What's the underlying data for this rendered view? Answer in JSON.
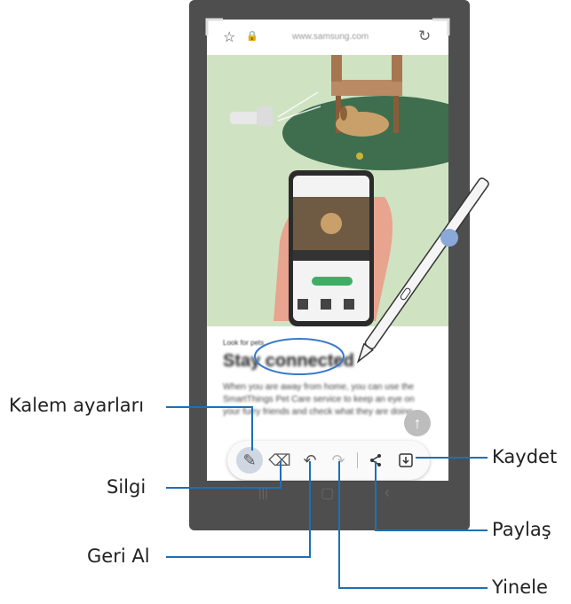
{
  "browser": {
    "url": "www.samsung.com"
  },
  "article": {
    "kicker": "Look for pets",
    "headline": "Stay connected",
    "body": "When you are away from home, you can use the SmartThings Pet Care service to keep an eye on your furry friends and check what they are doing."
  },
  "callouts": {
    "pen_settings": "Kalem ayarları",
    "eraser": "Silgi",
    "undo": "Geri Al",
    "redo": "Yinele",
    "share": "Paylaş",
    "save": "Kaydet"
  },
  "icons": {
    "bookmark": "star-icon",
    "lock": "lock-icon",
    "refresh": "refresh-icon",
    "pen": "pen-icon",
    "eraser": "eraser-icon",
    "undo": "undo-icon",
    "redo": "redo-icon",
    "share": "share-icon",
    "save": "save-icon",
    "scroll_up": "arrow-up-icon"
  },
  "colors": {
    "callout_line": "#1f6fb5",
    "hero_bg": "#cfe3c2",
    "phone_frame": "#4e4e4e"
  }
}
